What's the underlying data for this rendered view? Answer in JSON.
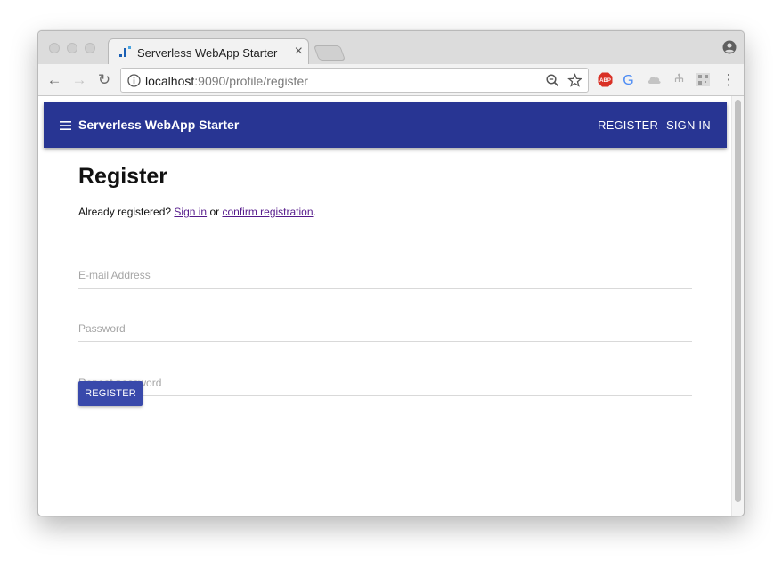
{
  "browser": {
    "tab_title": "Serverless WebApp Starter",
    "tab_close": "×",
    "url_host": "localhost",
    "url_rest": ":9090/profile/register",
    "nav": {
      "back": "←",
      "forward": "→",
      "reload": "↻"
    },
    "extensions": [
      "abp-icon",
      "google-translate-icon",
      "drive-icon",
      "tree-icon",
      "qr-icon"
    ],
    "menu": "⋮"
  },
  "app": {
    "title": "Serverless WebApp Starter",
    "nav_register": "REGISTER",
    "nav_signin": "SIGN IN",
    "accent_color": "#283593",
    "button_color": "#3949ab"
  },
  "form": {
    "title": "Register",
    "prefix": "Already registered?",
    "signin_link": "Sign in",
    "or": "or",
    "confirm_link": "confirm registration",
    "suffix": ".",
    "email_placeholder": "E-mail Address",
    "password_placeholder": "Password",
    "repeat_placeholder": "Repeat password",
    "submit_label": "REGISTER"
  }
}
